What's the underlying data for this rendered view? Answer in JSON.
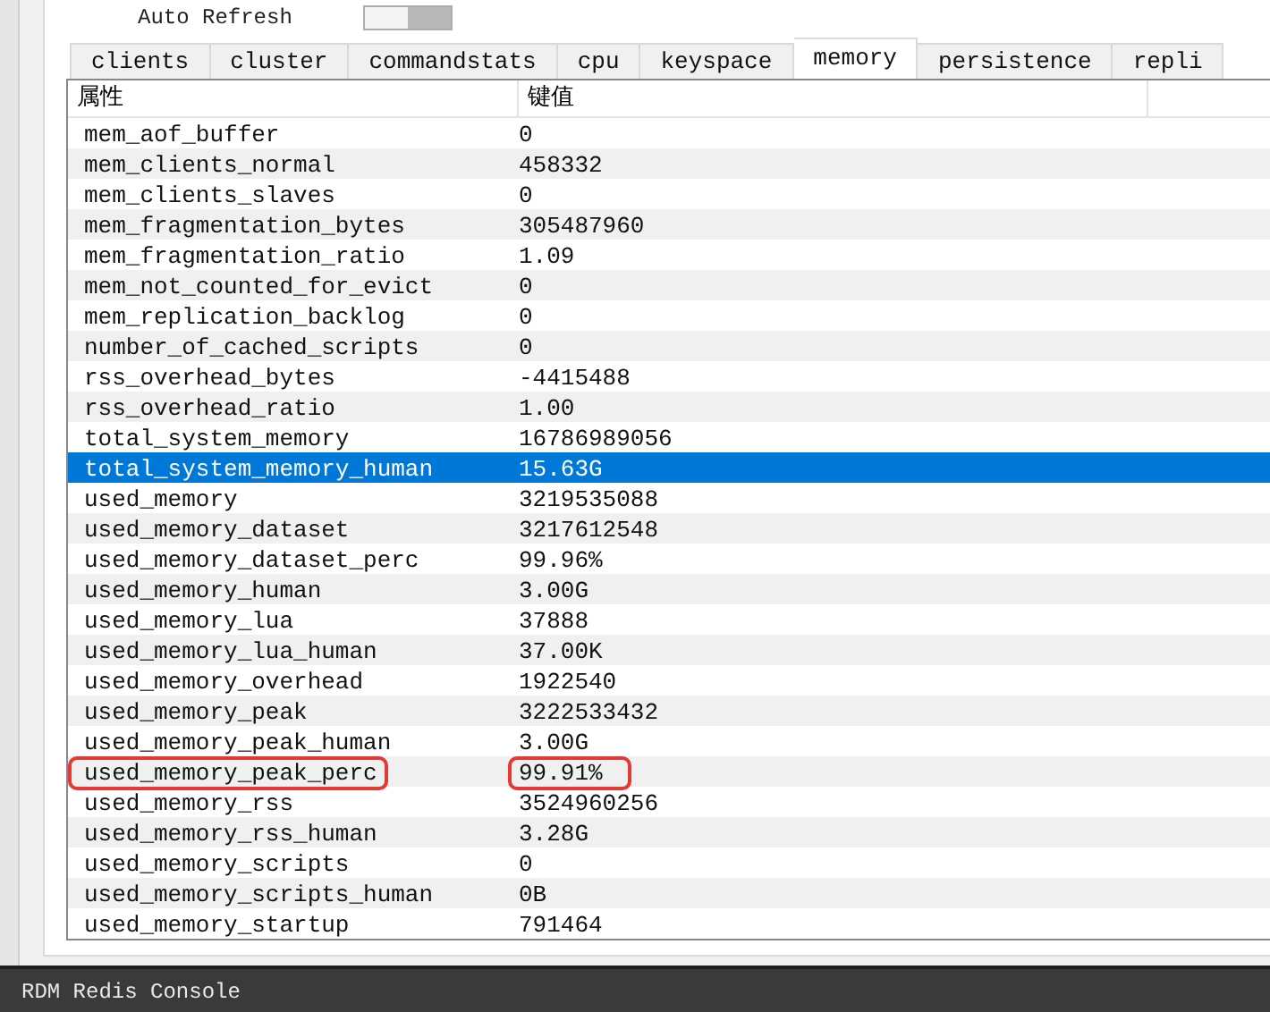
{
  "toolbar": {
    "auto_refresh_label": "Auto Refresh",
    "auto_refresh_on": false
  },
  "tabs": [
    {
      "label": "clients",
      "selected": false
    },
    {
      "label": "cluster",
      "selected": false
    },
    {
      "label": "commandstats",
      "selected": false
    },
    {
      "label": "cpu",
      "selected": false
    },
    {
      "label": "keyspace",
      "selected": false
    },
    {
      "label": "memory",
      "selected": true
    },
    {
      "label": "persistence",
      "selected": false
    },
    {
      "label": "repli",
      "selected": false
    }
  ],
  "table": {
    "columns": [
      "属性",
      "键值"
    ],
    "rows": [
      {
        "key": "mem_aof_buffer",
        "value": "0",
        "selected": false,
        "highlighted": false
      },
      {
        "key": "mem_clients_normal",
        "value": "458332",
        "selected": false,
        "highlighted": false
      },
      {
        "key": "mem_clients_slaves",
        "value": "0",
        "selected": false,
        "highlighted": false
      },
      {
        "key": "mem_fragmentation_bytes",
        "value": "305487960",
        "selected": false,
        "highlighted": false
      },
      {
        "key": "mem_fragmentation_ratio",
        "value": "1.09",
        "selected": false,
        "highlighted": false
      },
      {
        "key": "mem_not_counted_for_evict",
        "value": "0",
        "selected": false,
        "highlighted": false
      },
      {
        "key": "mem_replication_backlog",
        "value": "0",
        "selected": false,
        "highlighted": false
      },
      {
        "key": "number_of_cached_scripts",
        "value": "0",
        "selected": false,
        "highlighted": false
      },
      {
        "key": "rss_overhead_bytes",
        "value": "-4415488",
        "selected": false,
        "highlighted": false
      },
      {
        "key": "rss_overhead_ratio",
        "value": "1.00",
        "selected": false,
        "highlighted": false
      },
      {
        "key": "total_system_memory",
        "value": "16786989056",
        "selected": false,
        "highlighted": false
      },
      {
        "key": "total_system_memory_human",
        "value": "15.63G",
        "selected": true,
        "highlighted": false
      },
      {
        "key": "used_memory",
        "value": "3219535088",
        "selected": false,
        "highlighted": false
      },
      {
        "key": "used_memory_dataset",
        "value": "3217612548",
        "selected": false,
        "highlighted": false
      },
      {
        "key": "used_memory_dataset_perc",
        "value": "99.96%",
        "selected": false,
        "highlighted": false
      },
      {
        "key": "used_memory_human",
        "value": "3.00G",
        "selected": false,
        "highlighted": false
      },
      {
        "key": "used_memory_lua",
        "value": "37888",
        "selected": false,
        "highlighted": false
      },
      {
        "key": "used_memory_lua_human",
        "value": "37.00K",
        "selected": false,
        "highlighted": false
      },
      {
        "key": "used_memory_overhead",
        "value": "1922540",
        "selected": false,
        "highlighted": false
      },
      {
        "key": "used_memory_peak",
        "value": "3222533432",
        "selected": false,
        "highlighted": false
      },
      {
        "key": "used_memory_peak_human",
        "value": "3.00G",
        "selected": false,
        "highlighted": false
      },
      {
        "key": "used_memory_peak_perc",
        "value": "99.91%",
        "selected": false,
        "highlighted": true
      },
      {
        "key": "used_memory_rss",
        "value": "3524960256",
        "selected": false,
        "highlighted": false
      },
      {
        "key": "used_memory_rss_human",
        "value": "3.28G",
        "selected": false,
        "highlighted": false
      },
      {
        "key": "used_memory_scripts",
        "value": "0",
        "selected": false,
        "highlighted": false
      },
      {
        "key": "used_memory_scripts_human",
        "value": "0B",
        "selected": false,
        "highlighted": false
      },
      {
        "key": "used_memory_startup",
        "value": "791464",
        "selected": false,
        "highlighted": false
      }
    ]
  },
  "console": {
    "title": "RDM Redis Console"
  }
}
